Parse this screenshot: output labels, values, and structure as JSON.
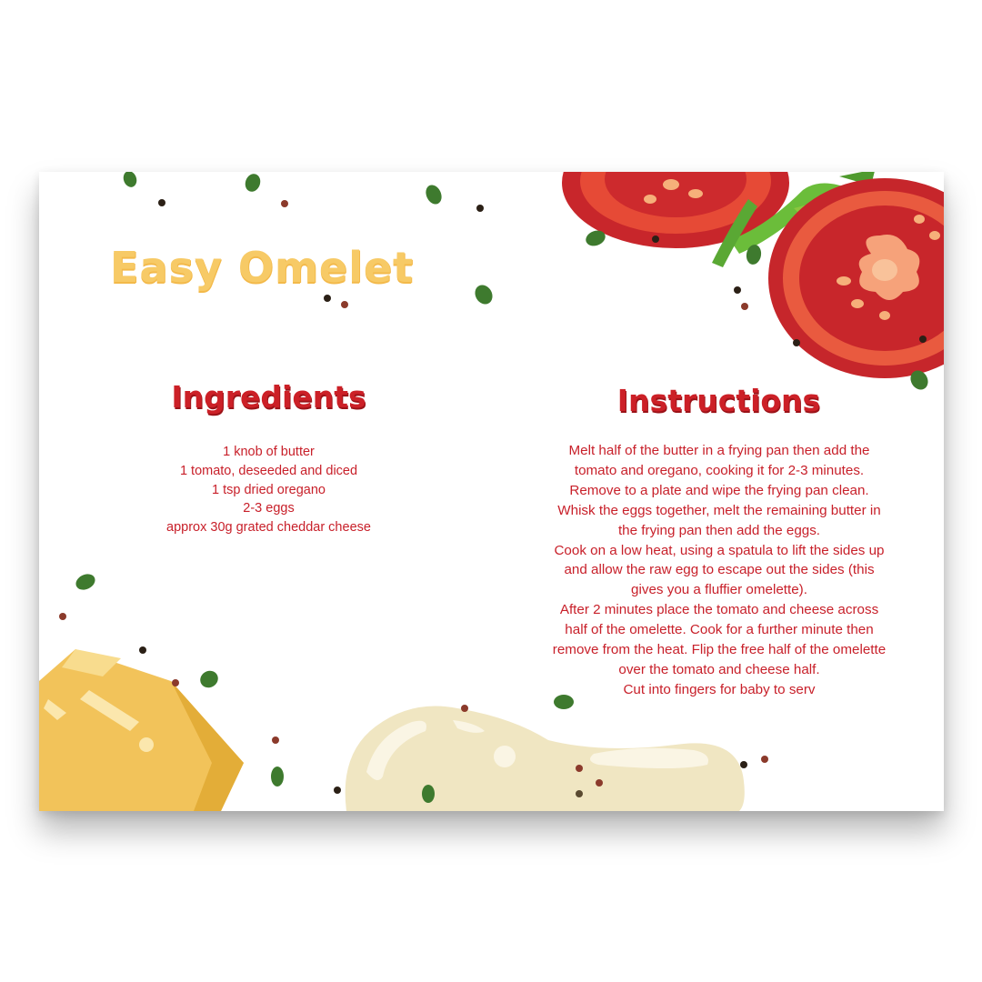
{
  "recipe": {
    "title": "Easy Omelet",
    "ingredients_heading": "Ingredients",
    "ingredients": [
      "1 knob of butter",
      "1 tomato, deseeded and diced",
      "1 tsp dried oregano",
      "2-3 eggs",
      "approx 30g grated cheddar cheese"
    ],
    "instructions_heading": "Instructions",
    "instructions_lines": [
      "Melt half of the butter in a frying pan then add the",
      "tomato and oregano, cooking it for 2-3 minutes.",
      "Remove to a plate and wipe the frying pan clean.",
      "Whisk the eggs together, melt the remaining butter in",
      "the frying pan then add the eggs.",
      "Cook on a low heat, using a spatula to lift the sides up",
      "and allow the raw egg to escape out the sides (this",
      "gives you a fluffier omelette).",
      "After 2 minutes place the tomato and cheese across",
      "half of the omelette. Cook for a further minute then",
      "remove from the heat. Flip the free half of the omelette",
      "over the tomato and cheese half.",
      "Cut into fingers for baby to serv"
    ]
  },
  "colors": {
    "title": "#f7ca66",
    "heading": "#cc2027",
    "body_text": "#c8202a",
    "tomato": "#d42f2c",
    "butter": "#f2c35a",
    "egg": "#f1e7c4",
    "herb": "#3e7a2e"
  },
  "illustrations": [
    "tomato-slices",
    "butter-block",
    "egg-puddle",
    "herb-sprinkles"
  ]
}
